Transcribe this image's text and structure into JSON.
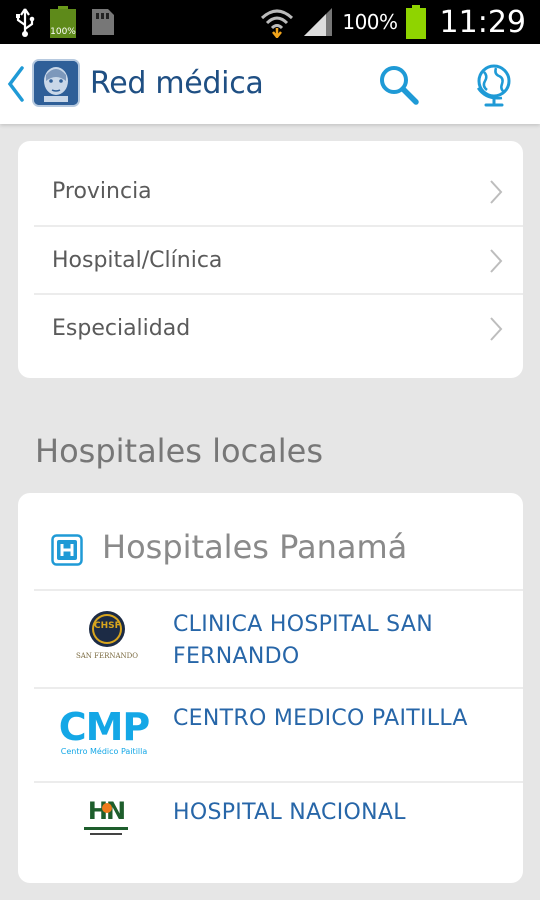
{
  "status_bar": {
    "battery_small_label": "100%",
    "battery_pct": "100%",
    "time": "11:29"
  },
  "app_bar": {
    "title": "Red médica"
  },
  "filters": [
    {
      "label": "Provincia"
    },
    {
      "label": "Hospital/Clínica"
    },
    {
      "label": "Especialidad"
    }
  ],
  "section": {
    "title": "Hospitales locales"
  },
  "hospitals_card": {
    "heading": "Hospitales Panamá",
    "items": [
      {
        "name": "CLINICA HOSPITAL SAN FERNANDO",
        "logo_text": "CHSF",
        "logo_caption": "SAN FERNANDO"
      },
      {
        "name": "CENTRO MEDICO PAITILLA",
        "logo_text": "CMP",
        "logo_caption": "Centro Médico Paitilla"
      },
      {
        "name": "HOSPITAL NACIONAL",
        "logo_text": "HN"
      }
    ]
  },
  "colors": {
    "accent": "#1f9ad6",
    "title_blue": "#1f4f83",
    "link_blue": "#2766a8",
    "battery_green": "#8fd400"
  }
}
